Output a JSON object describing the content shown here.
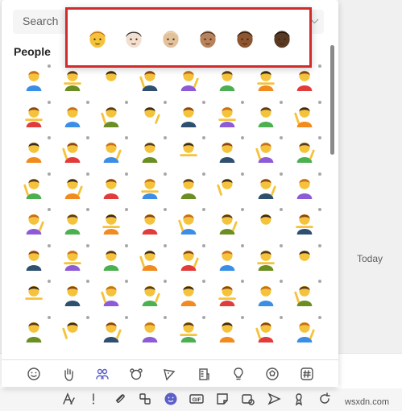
{
  "search": {
    "placeholder": "Search"
  },
  "category_title": "People",
  "side_label": "Today",
  "skin_tones": [
    {
      "name": "default-yellow",
      "skin": "#f5c33b",
      "hair": "#c76e1a"
    },
    {
      "name": "light",
      "skin": "#f3dfd0",
      "hair": "#2b2b2b"
    },
    {
      "name": "medium-light",
      "skin": "#e2c19b",
      "hair": "#e8d5b4"
    },
    {
      "name": "medium",
      "skin": "#b8825c",
      "hair": "#4a2e1d"
    },
    {
      "name": "medium-dark",
      "skin": "#8d5530",
      "hair": "#2b1a10"
    },
    {
      "name": "dark",
      "skin": "#5a3922",
      "hair": "#1a100a"
    }
  ],
  "category_bar": [
    {
      "name": "smileys",
      "icon": "smiley-icon"
    },
    {
      "name": "hand-gestures",
      "icon": "hand-icon"
    },
    {
      "name": "people",
      "icon": "people-icon",
      "active": true
    },
    {
      "name": "animals",
      "icon": "animal-icon"
    },
    {
      "name": "food",
      "icon": "pizza-icon"
    },
    {
      "name": "travel",
      "icon": "building-icon"
    },
    {
      "name": "objects",
      "icon": "lightbulb-icon"
    },
    {
      "name": "activities",
      "icon": "ball-icon"
    },
    {
      "name": "symbols",
      "icon": "hash-icon"
    }
  ],
  "toolbar": [
    {
      "name": "format",
      "icon": "format-icon"
    },
    {
      "name": "important",
      "icon": "exclamation-icon"
    },
    {
      "name": "attach",
      "icon": "paperclip-icon"
    },
    {
      "name": "loop",
      "icon": "loop-icon"
    },
    {
      "name": "emoji",
      "icon": "emoji-icon",
      "active": true
    },
    {
      "name": "gif",
      "icon": "gif-icon",
      "label": "GIF"
    },
    {
      "name": "sticker",
      "icon": "sticker-icon"
    },
    {
      "name": "meet",
      "icon": "meet-now-icon"
    },
    {
      "name": "deliver",
      "icon": "send-arrow-icon"
    },
    {
      "name": "praise",
      "icon": "praise-icon"
    },
    {
      "name": "refresh",
      "icon": "refresh-icon"
    }
  ],
  "toolbar_watermark": "wsxdn.com",
  "colors": {
    "skin_default": "#f5c33b",
    "shirt_blue": "#3a8ee6",
    "shirt_red": "#e23b3b",
    "shirt_orange": "#f28a1e",
    "highlight_border": "#d22b2b",
    "accent_purple": "#5b5fc7"
  }
}
